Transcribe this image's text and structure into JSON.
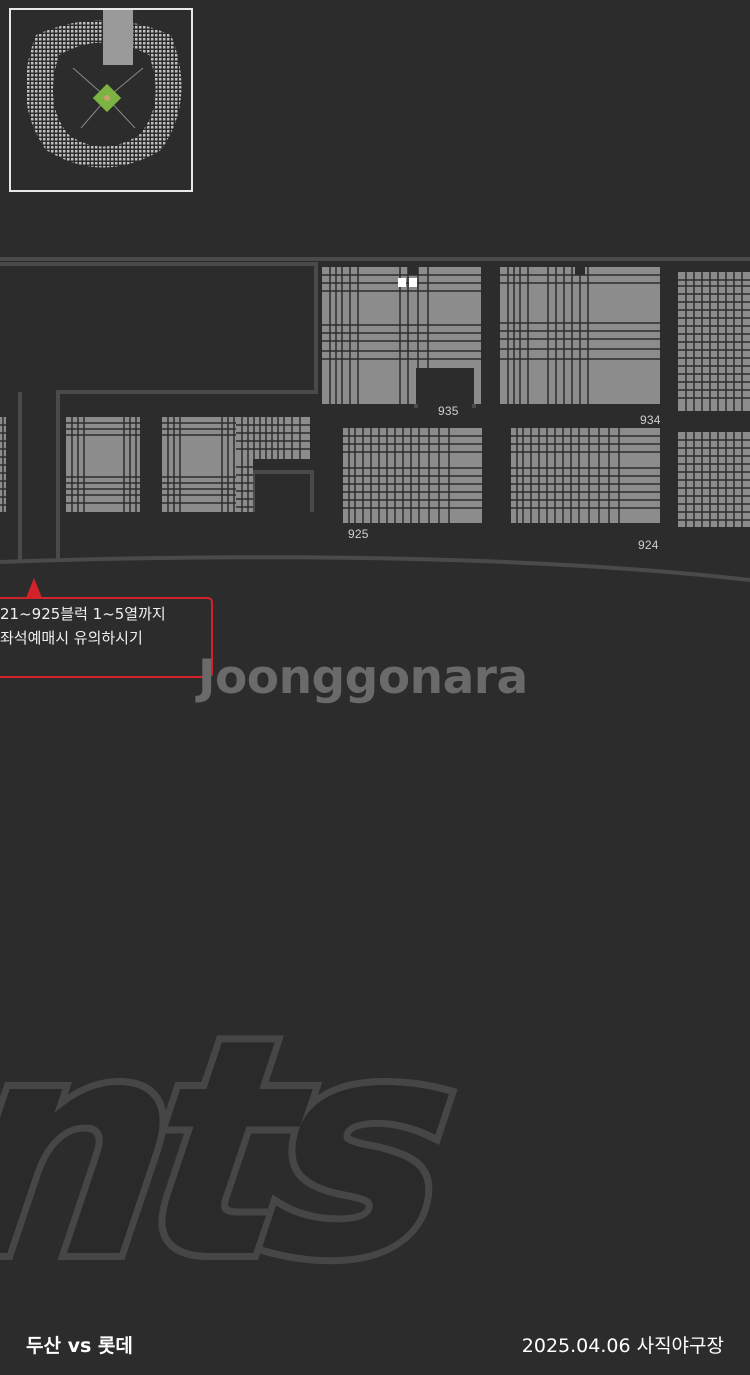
{
  "minimap": {
    "label": "stadium-overview"
  },
  "seat_map": {
    "blocks": [
      {
        "id": "935",
        "label": "935"
      },
      {
        "id": "934",
        "label": "934"
      },
      {
        "id": "925",
        "label": "925"
      },
      {
        "id": "924",
        "label": "924"
      }
    ],
    "selected_seats": 2
  },
  "notice": {
    "line1": "21~925블럭 1~5열까지",
    "line2": "좌석예매시 유의하시기"
  },
  "watermark": {
    "text": "Joonggonara"
  },
  "background_logo": {
    "text": "nts"
  },
  "footer": {
    "match": "두산 vs 롯데",
    "date_venue": "2025.04.06 사직야구장"
  },
  "colors": {
    "background": "#2c2c2c",
    "seat": "#8c8c8c",
    "notice_border": "#d2232a",
    "field_green": "#7cb342"
  }
}
